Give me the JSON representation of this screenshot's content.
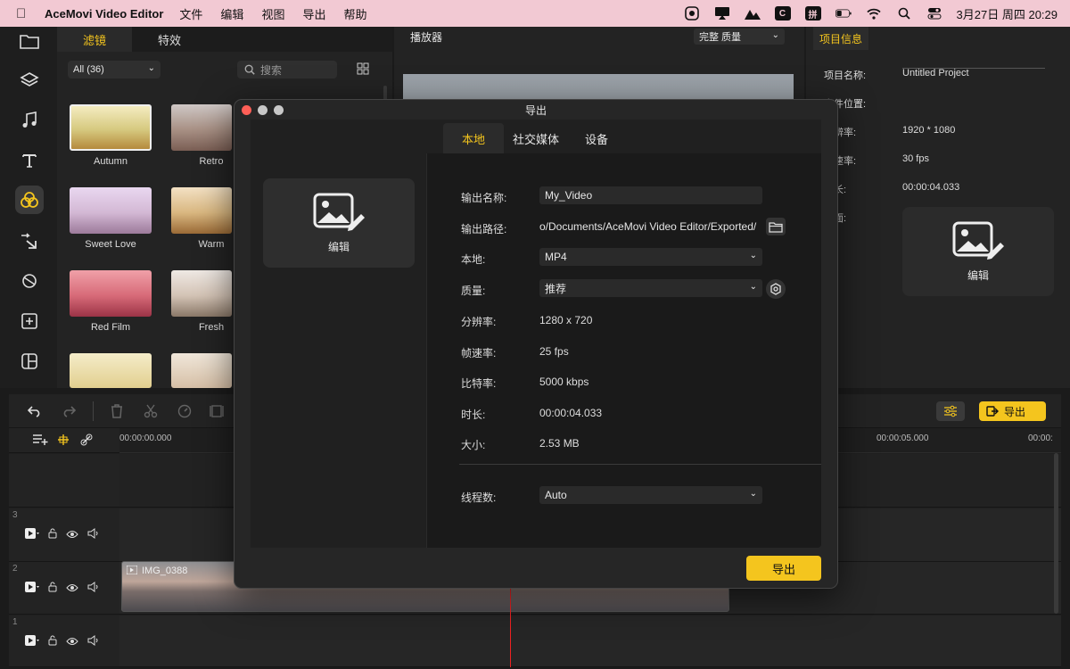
{
  "menubar": {
    "app_name": "AceMovi Video Editor",
    "menus": [
      "文件",
      "编辑",
      "视图",
      "导出",
      "帮助"
    ],
    "input_method": "拼",
    "datetime": "3月27日 周四  20:29"
  },
  "filters": {
    "tabs": [
      "滤镜",
      "特效"
    ],
    "category": "All (36)",
    "search_placeholder": "搜索",
    "items": [
      "Autumn",
      "Retro",
      "Sweet Love",
      "Warm",
      "Red Film",
      "Fresh"
    ]
  },
  "player": {
    "title": "播放器",
    "quality": "完整 质量"
  },
  "project_info": {
    "tab": "项目信息",
    "rows": [
      {
        "label": "项目名称:",
        "value": "Untitled Project"
      },
      {
        "label": "文件位置:",
        "value": ""
      },
      {
        "label": "分辨率:",
        "value": "1920 * 1080"
      },
      {
        "label": "帧速率:",
        "value": "30 fps"
      },
      {
        "label": "时长:",
        "value": "00:00:04.033"
      },
      {
        "label": "封面:",
        "value": ""
      }
    ],
    "cover_label": "编辑"
  },
  "timeline": {
    "export_label": "导出",
    "ruler": [
      "00:00:00.000",
      "00:00:05.000",
      "00:00:"
    ],
    "tracks": [
      "3",
      "2",
      "1"
    ],
    "clip_name": "IMG_0388"
  },
  "export_dialog": {
    "title": "导出",
    "tabs": [
      "本地",
      "社交媒体",
      "设备"
    ],
    "cover_label": "编辑",
    "fields": {
      "name_label": "输出名称:",
      "name_value": "My_Video",
      "path_label": "输出路径:",
      "path_value": "o/Documents/AceMovi Video Editor/Exported/",
      "format_label": "本地:",
      "format_value": "MP4",
      "quality_label": "质量:",
      "quality_value": "推荐",
      "resolution_label": "分辨率:",
      "resolution_value": "1280 x 720",
      "framerate_label": "帧速率:",
      "framerate_value": "25 fps",
      "bitrate_label": "比特率:",
      "bitrate_value": "5000 kbps",
      "duration_label": "时长:",
      "duration_value": "00:00:04.033",
      "size_label": "大小:",
      "size_value": "2.53 MB",
      "threads_label": "线程数:",
      "threads_value": "Auto"
    },
    "export_button": "导出"
  },
  "colors": {
    "accent": "#f4c51e",
    "menubar": "#f2c9d3",
    "playhead": "#e22222"
  }
}
